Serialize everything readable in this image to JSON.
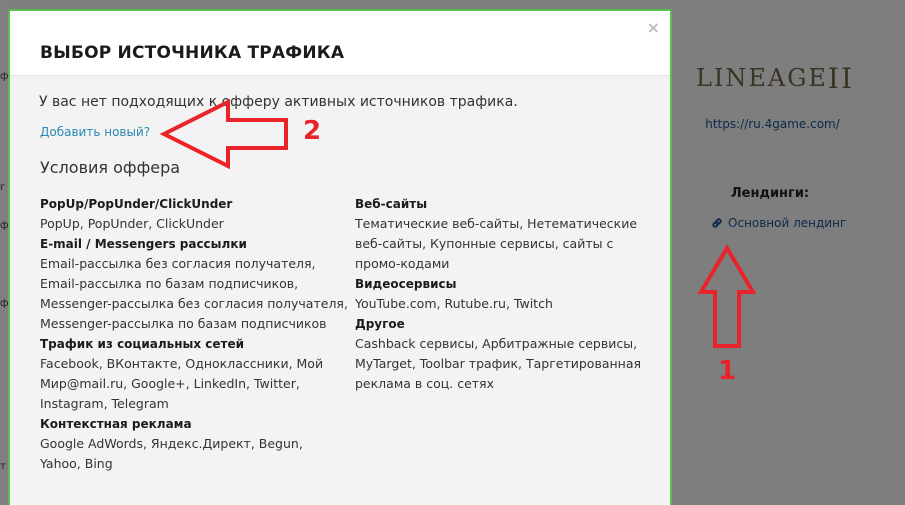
{
  "background": {
    "logo_text": "LINEAGE",
    "logo_numeral": "II",
    "url": "https://ru.4game.com/",
    "landings_title": "Лендинги:",
    "landing_link": "Основной лендинг",
    "left_edge_letters": [
      "ф",
      "г",
      "ф",
      "ф",
      "т"
    ]
  },
  "modal": {
    "title": "ВЫБОР ИСТОЧНИКА ТРАФИКА",
    "close_label": "×",
    "notice": "У вас нет подходящих к офферу активных источников трафика.",
    "add_new_link": "Добавить новый?",
    "conditions_title": "Условия оффера",
    "left_groups": [
      {
        "title": "PopUp/PopUnder/ClickUnder",
        "lines": [
          "PopUp, PopUnder, ClickUnder"
        ]
      },
      {
        "title": "E-mail / Messengers рассылки",
        "lines": [
          "Email-рассылка без согласия получателя,",
          "Email-рассылка по базам подписчиков,",
          "Messenger-рассылка без согласия получателя,",
          "Messenger-рассылка по базам подписчиков"
        ]
      },
      {
        "title": "Трафик из социальных сетей",
        "lines": [
          "Facebook, ВКонтакте, Одноклассники, Мой",
          "Мир@mail.ru, Google+, LinkedIn, Twitter,",
          "Instagram, Telegram"
        ]
      },
      {
        "title": "Контекстная реклама",
        "lines": [
          "Google AdWords, Яндекс.Директ, Begun,",
          "Yahoo, Bing"
        ]
      }
    ],
    "right_groups": [
      {
        "title": "Веб-сайты",
        "lines": [
          "Тематические веб-сайты, Нетематические",
          "веб-сайты, Купонные сервисы, сайты с",
          "промо-кодами"
        ]
      },
      {
        "title": "Видеосервисы",
        "lines": [
          "YouTube.com, Rutube.ru, Twitch"
        ]
      },
      {
        "title": "Другое",
        "lines": [
          "Cashback сервисы, Арбитражные сервисы,",
          "MyTarget, Toolbar трафик, Таргетированная",
          "реклама в соц. сетях"
        ]
      }
    ]
  },
  "annotations": {
    "arrow_1_label": "1",
    "arrow_2_label": "2",
    "color": "#e8232a"
  }
}
